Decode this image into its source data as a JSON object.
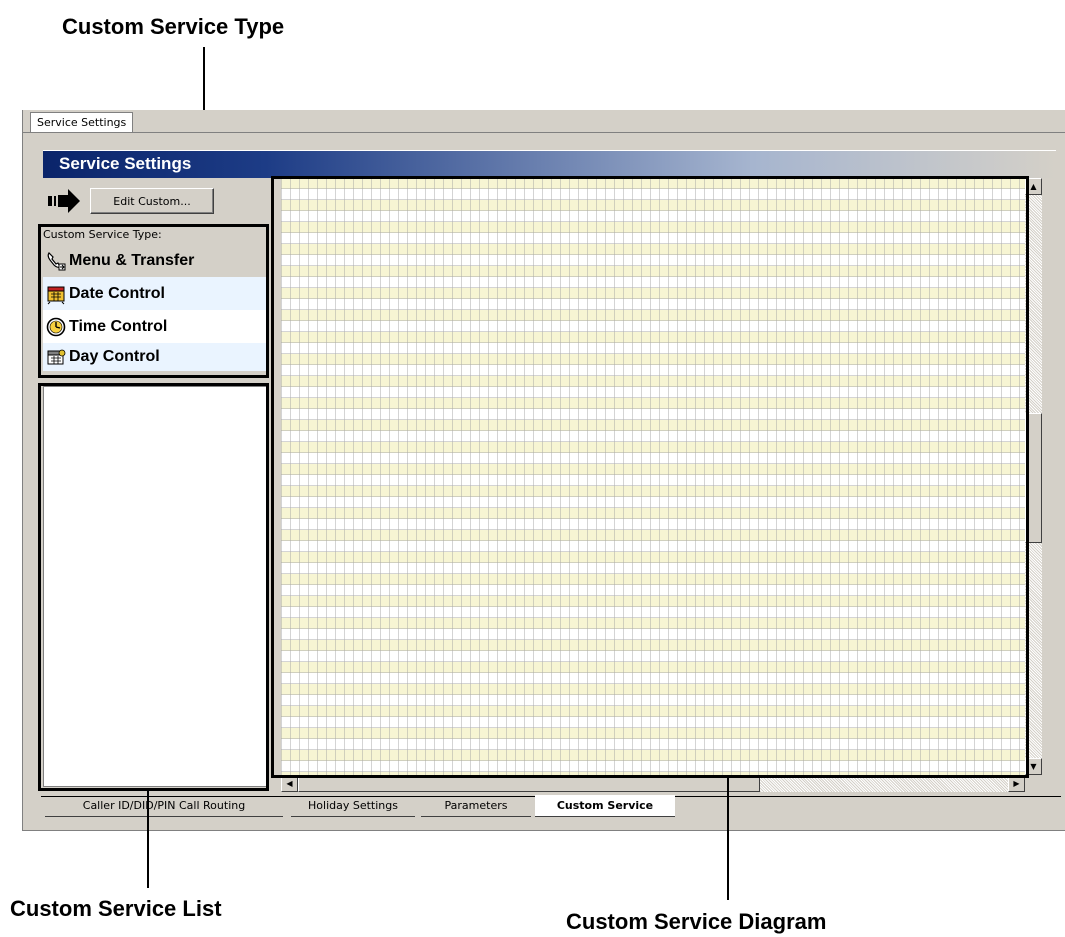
{
  "callouts": {
    "custom_service_type": "Custom Service Type",
    "custom_service_list": "Custom Service List",
    "custom_service_diagram": "Custom Service Diagram"
  },
  "window": {
    "top_tab": "Service Settings",
    "title": "Service Settings",
    "edit_button": "Edit Custom...",
    "type_label": "Custom Service Type:"
  },
  "service_types": [
    {
      "label": "Menu & Transfer",
      "icon": "phone-transfer-icon"
    },
    {
      "label": "Date Control",
      "icon": "calendar-date-icon"
    },
    {
      "label": "Time Control",
      "icon": "clock-icon"
    },
    {
      "label": "Day Control",
      "icon": "calendar-day-icon"
    }
  ],
  "bottom_tabs": [
    {
      "label": "Caller ID/DID/PIN Call Routing",
      "active": false
    },
    {
      "label": "Holiday Settings",
      "active": false
    },
    {
      "label": "Parameters",
      "active": false
    },
    {
      "label": "Custom Service",
      "active": true
    }
  ],
  "colors": {
    "title_bar": "#0a246a",
    "diagram_row": "#f7f5d3",
    "selected_item": "#d4d0c8",
    "alt_item": "#eaf4ff"
  }
}
